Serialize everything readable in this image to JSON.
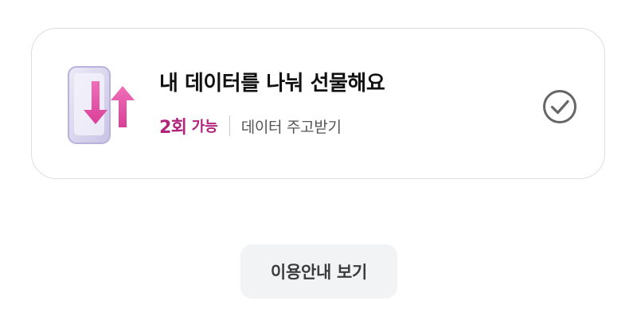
{
  "card": {
    "title": "내 데이터를 나눠 선물해요",
    "count": "2회",
    "availability": "가능",
    "description": "데이터 주고받기",
    "accent_color": "#b0247c",
    "icon": "phone-data-transfer-icon",
    "check_icon": "check-circle-icon"
  },
  "guide_button": {
    "label": "이용안내 보기"
  }
}
